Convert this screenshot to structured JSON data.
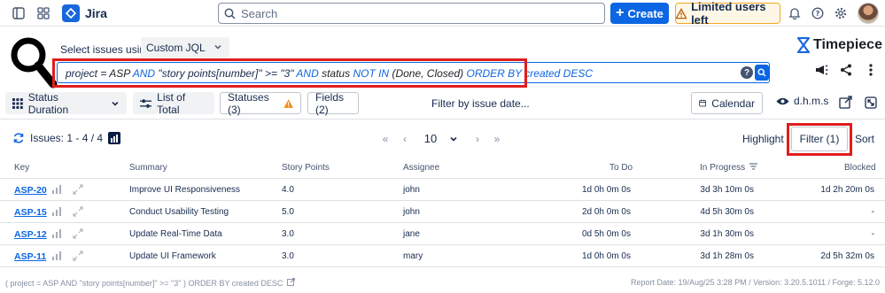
{
  "app": {
    "name": "Jira",
    "search_placeholder": "Search",
    "create_label": "Create",
    "limited_label": "Limited users left"
  },
  "jql": {
    "select_label": "Select issues using",
    "mode": "Custom JQL",
    "parts": {
      "p1": "project",
      "p2": " = ASP ",
      "p3": "AND",
      "p4": " \"story points[number]\" >= \"3\" ",
      "p5": "AND",
      "p6": " status ",
      "p7": "NOT IN",
      "p8": " (Done, Closed) ",
      "p9": "ORDER BY",
      "p10": " created DESC"
    }
  },
  "brand": {
    "name": "Timepiece"
  },
  "toolbar": {
    "status_duration": "Status Duration",
    "list_of_total": "List of Total",
    "statuses": "Statuses (3)",
    "fields": "Fields (2)",
    "filter_by_date": "Filter by issue date...",
    "calendar": "Calendar",
    "time_format": "d.h.m.s"
  },
  "results": {
    "issues_label": "Issues: 1 - 4 / 4",
    "page_size": "10",
    "highlight": "Highlight",
    "filter": "Filter (1)",
    "sort": "Sort"
  },
  "table": {
    "headers": {
      "key": "Key",
      "summary": "Summary",
      "story_points": "Story Points",
      "assignee": "Assignee",
      "todo": "To Do",
      "in_progress": "In Progress",
      "blocked": "Blocked"
    },
    "rows": [
      {
        "key": "ASP-20",
        "summary": "Improve UI Responsiveness",
        "points": "4.0",
        "assignee": "john",
        "todo": "1d 0h 0m 0s",
        "in_progress": "3d 3h 10m 0s",
        "blocked": "1d 2h 20m 0s"
      },
      {
        "key": "ASP-15",
        "summary": "Conduct Usability Testing",
        "points": "5.0",
        "assignee": "john",
        "todo": "2d 0h 0m 0s",
        "in_progress": "4d 5h 30m 0s",
        "blocked": "-"
      },
      {
        "key": "ASP-12",
        "summary": "Update Real-Time Data",
        "points": "3.0",
        "assignee": "jane",
        "todo": "0d 5h 0m 0s",
        "in_progress": "3d 1h 30m 0s",
        "blocked": "-"
      },
      {
        "key": "ASP-11",
        "summary": "Update UI Framework",
        "points": "3.0",
        "assignee": "mary",
        "todo": "1d 0h 0m 0s",
        "in_progress": "3d 1h 28m 0s",
        "blocked": "2d 5h 32m 0s"
      }
    ]
  },
  "footer": {
    "query": "( project = ASP AND \"story points[number]\" >= \"3\" ) ORDER BY created DESC",
    "report": "Report Date: 19/Aug/25 3:28 PM / Version: 3.20.5.1011 / Forge: 5.12.0"
  },
  "colors": {
    "accent": "#0c66e4",
    "highlight_box": "#e11d1d",
    "warning": "#f5a623"
  }
}
